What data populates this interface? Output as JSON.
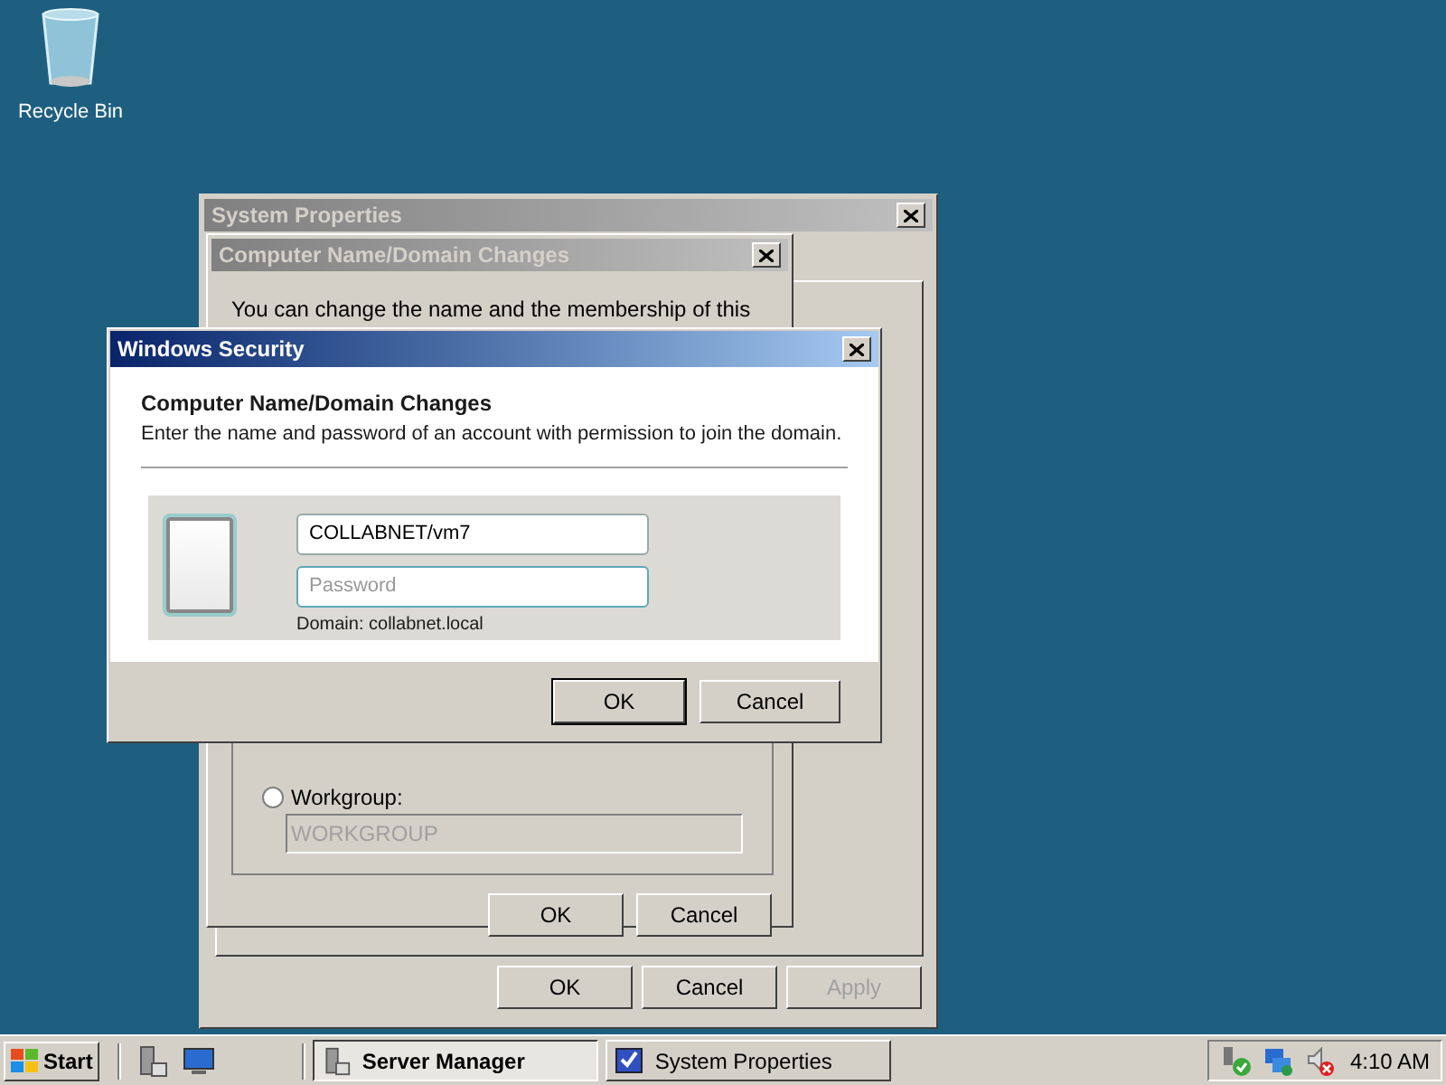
{
  "desktop_icons": [
    {
      "label": "Recycle Bin"
    }
  ],
  "system_properties": {
    "title": "System Properties",
    "active": false,
    "buttons": [
      {
        "label": "OK",
        "disabled": false
      },
      {
        "label": "Cancel",
        "disabled": false
      },
      {
        "label": "Apply",
        "disabled": true
      }
    ]
  },
  "domain_changes": {
    "title": "Computer Name/Domain Changes",
    "active": false,
    "intro": "You can change the name and the membership of this",
    "workgroup": {
      "label": "Workgroup:",
      "selected": false,
      "value": "WORKGROUP",
      "disabled": true
    },
    "buttons": [
      {
        "label": "OK",
        "disabled": false
      },
      {
        "label": "Cancel",
        "disabled": false
      }
    ]
  },
  "security": {
    "title": "Windows Security",
    "active": true,
    "heading": "Computer Name/Domain Changes",
    "description": "Enter the name and password of an account with permission to join the domain.",
    "username": {
      "value": "COLLABNET/vm7"
    },
    "password": {
      "placeholder": "Password"
    },
    "domain": "Domain: collabnet.local",
    "buttons": [
      {
        "label": "OK",
        "default": true
      },
      {
        "label": "Cancel",
        "default": false
      }
    ]
  },
  "taskbar": {
    "start": "Start",
    "tasks": [
      {
        "label": "Server Manager",
        "selected": true
      },
      {
        "label": "System Properties",
        "selected": false
      }
    ],
    "clock": "4:10 AM"
  }
}
